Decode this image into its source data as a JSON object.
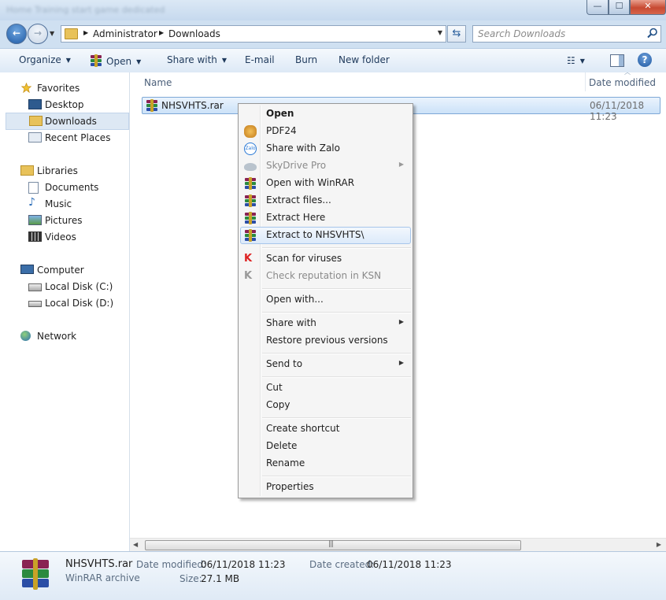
{
  "window": {
    "title_blurred": "Home Training start game dedicated",
    "controls": {
      "minimize": "—",
      "maximize": "☐",
      "close": "✕"
    }
  },
  "address": {
    "crumbs": [
      "Administrator",
      "Downloads"
    ],
    "search_placeholder": "Search Downloads"
  },
  "toolbar": {
    "organize": "Organize",
    "open": "Open",
    "share_with": "Share with",
    "email": "E-mail",
    "burn": "Burn",
    "new_folder": "New folder"
  },
  "nav": {
    "favorites": "Favorites",
    "desktop": "Desktop",
    "downloads": "Downloads",
    "recent_places": "Recent Places",
    "libraries": "Libraries",
    "documents": "Documents",
    "music": "Music",
    "pictures": "Pictures",
    "videos": "Videos",
    "computer": "Computer",
    "local_c": "Local Disk (C:)",
    "local_d": "Local Disk (D:)",
    "network": "Network"
  },
  "list": {
    "col_name": "Name",
    "col_date": "Date modified",
    "file": {
      "name": "NHSVHTS.rar",
      "date": "06/11/2018 11:23"
    }
  },
  "context_menu": {
    "open": "Open",
    "pdf24": "PDF24",
    "share_zalo": "Share with Zalo",
    "skydrive": "SkyDrive Pro",
    "open_winrar": "Open with WinRAR",
    "extract_files": "Extract files...",
    "extract_here": "Extract Here",
    "extract_to": "Extract to NHSVHTS\\",
    "scan": "Scan for viruses",
    "check_ksn": "Check reputation in KSN",
    "open_with": "Open with...",
    "share_with": "Share with",
    "restore": "Restore previous versions",
    "send_to": "Send to",
    "cut": "Cut",
    "copy": "Copy",
    "create_shortcut": "Create shortcut",
    "delete": "Delete",
    "rename": "Rename",
    "properties": "Properties"
  },
  "details": {
    "name": "NHSVHTS.rar",
    "type": "WinRAR archive",
    "modified_label": "Date modified:",
    "modified_value": "06/11/2018 11:23",
    "size_label": "Size:",
    "size_value": "27.1 MB",
    "created_label": "Date created:",
    "created_value": "06/11/2018 11:23"
  },
  "colors": {
    "accent": "#1f5ba6",
    "selection": "#cce2f8",
    "menu_bg": "#f5f5f5"
  }
}
